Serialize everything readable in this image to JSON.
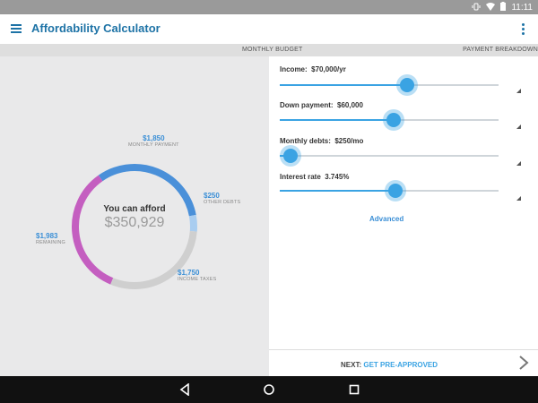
{
  "status_bar": {
    "time": "11:11"
  },
  "header": {
    "title": "Affordability Calculator"
  },
  "tabs": [
    {
      "label": "MONTHLY BUDGET"
    },
    {
      "label": "PAYMENT BREAKDOWN"
    }
  ],
  "summary": {
    "title": "You can afford",
    "value": "$350,929",
    "segments": [
      {
        "amount": "$1,850",
        "caption": "MONTHLY PAYMENT",
        "color": "#4a90d9"
      },
      {
        "amount": "$250",
        "caption": "OTHER DEBTS",
        "color": "#a9cdf0"
      },
      {
        "amount": "$1,750",
        "caption": "INCOME TAXES",
        "color": "#cfcfcf"
      },
      {
        "amount": "$1,983",
        "caption": "REMAINING",
        "color": "#c45ec0"
      }
    ]
  },
  "inputs": [
    {
      "label": "Income:",
      "value": "$70,000/yr",
      "slider_level": 0.58
    },
    {
      "label": "Down payment:",
      "value": "$60,000",
      "slider_level": 0.52
    },
    {
      "label": "Monthly debts:",
      "value": "$250/mo",
      "slider_level": 0.05
    },
    {
      "label": "Interest rate",
      "value": "3.745%",
      "slider_level": 0.53
    }
  ],
  "advanced_link": "Advanced",
  "next": {
    "prefix": "NEXT:",
    "link": "GET PRE-APPROVED"
  }
}
